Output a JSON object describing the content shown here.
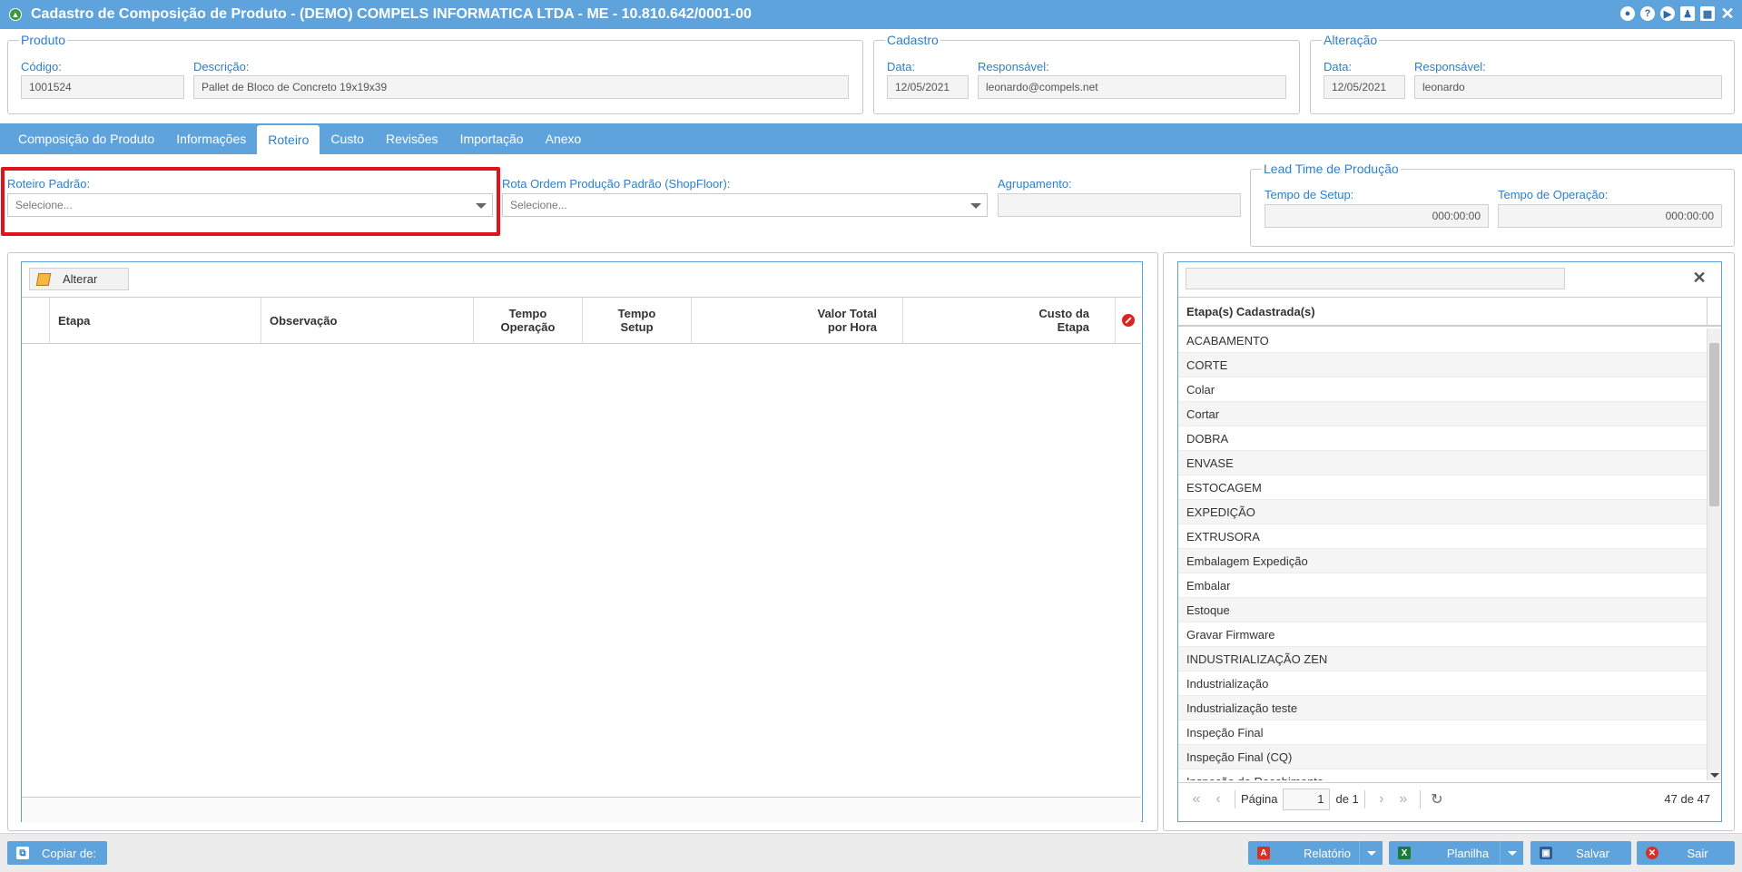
{
  "window": {
    "title": "Cadastro de Composição de Produto - (DEMO) COMPELS INFORMATICA LTDA - ME - 10.810.642/0001-00"
  },
  "produto": {
    "legend": "Produto",
    "codigo_label": "Código:",
    "codigo_value": "1001524",
    "descricao_label": "Descrição:",
    "descricao_value": "Pallet de Bloco de Concreto 19x19x39"
  },
  "cadastro": {
    "legend": "Cadastro",
    "data_label": "Data:",
    "data_value": "12/05/2021",
    "responsavel_label": "Responsável:",
    "responsavel_value": "leonardo@compels.net"
  },
  "alteracao": {
    "legend": "Alteração",
    "data_label": "Data:",
    "data_value": "12/05/2021",
    "responsavel_label": "Responsável:",
    "responsavel_value": "leonardo"
  },
  "tabs": [
    {
      "label": "Composição do Produto",
      "active": false
    },
    {
      "label": "Informações",
      "active": false
    },
    {
      "label": "Roteiro",
      "active": true
    },
    {
      "label": "Custo",
      "active": false
    },
    {
      "label": "Revisões",
      "active": false
    },
    {
      "label": "Importação",
      "active": false
    },
    {
      "label": "Anexo",
      "active": false
    }
  ],
  "roteiro": {
    "roteiro_padrao_label": "Roteiro Padrão:",
    "roteiro_padrao_value": "Selecione...",
    "rota_label": "Rota Ordem Produção Padrão (ShopFloor):",
    "rota_value": "Selecione...",
    "agrupamento_label": "Agrupamento:",
    "agrupamento_value": ""
  },
  "lead_time": {
    "legend": "Lead Time de Produção",
    "setup_label": "Tempo de Setup:",
    "setup_value": "000:00:00",
    "operacao_label": "Tempo de Operação:",
    "operacao_value": "000:00:00"
  },
  "grid": {
    "alterar_label": "Alterar",
    "columns": {
      "etapa": "Etapa",
      "observacao": "Observação",
      "tempo_operacao_1": "Tempo",
      "tempo_operacao_2": "Operação",
      "tempo_setup_1": "Tempo",
      "tempo_setup_2": "Setup",
      "valor_total_1": "Valor Total",
      "valor_total_2": "por Hora",
      "custo_etapa_1": "Custo da",
      "custo_etapa_2": "Etapa"
    },
    "rows": []
  },
  "etapas": {
    "search_value": "",
    "header": "Etapa(s) Cadastrada(s)",
    "items": [
      "ACABAMENTO",
      "CORTE",
      "Colar",
      "Cortar",
      "DOBRA",
      "ENVASE",
      "ESTOCAGEM",
      "EXPEDIÇÃO",
      "EXTRUSORA",
      "Embalagem Expedição",
      "Embalar",
      "Estoque",
      "Gravar Firmware",
      "INDUSTRIALIZAÇÃO ZEN",
      "Industrialização",
      "Industrialização teste",
      "Inspeção Final",
      "Inspeção Final (CQ)",
      "Inspeção de Recebimento"
    ],
    "pager": {
      "pagina_label": "Página",
      "page": "1",
      "of_label": "de 1",
      "count": "47 de 47"
    }
  },
  "footer": {
    "copiar_label": "Copiar de:",
    "relatorio_label": "Relatório",
    "planilha_label": "Planilha",
    "salvar_label": "Salvar",
    "sair_label": "Sair"
  },
  "colors": {
    "primary": "#5fa3dd",
    "label": "#2e7fc7",
    "highlight": "#e0131d"
  }
}
